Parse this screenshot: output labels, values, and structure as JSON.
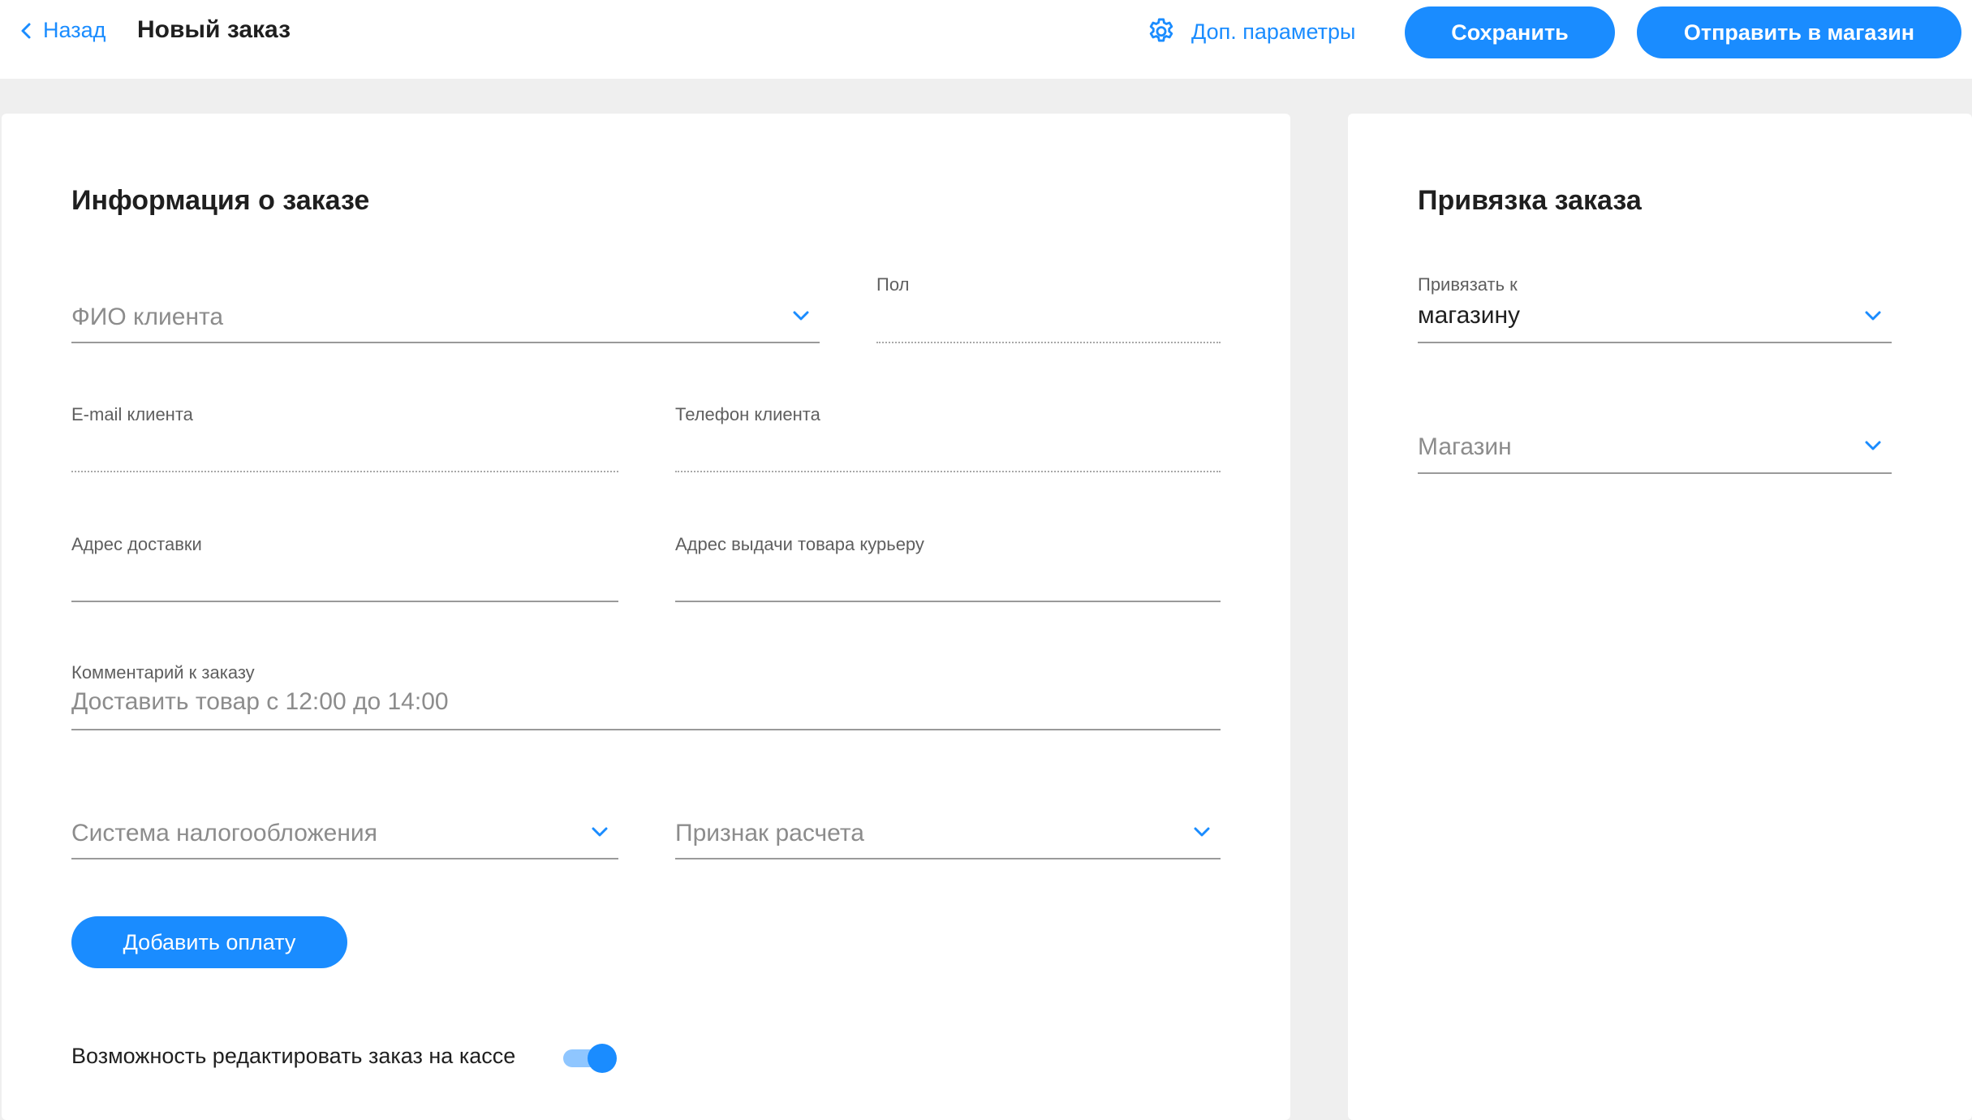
{
  "header": {
    "back_label": "Назад",
    "title": "Новый заказ",
    "extra_params_label": "Доп. параметры",
    "save_label": "Сохранить",
    "send_label": "Отправить в магазин"
  },
  "order_info": {
    "title": "Информация о заказе",
    "client_name": {
      "placeholder": "ФИО клиента"
    },
    "gender": {
      "label": "Пол",
      "value": ""
    },
    "email": {
      "label": "E-mail клиента",
      "value": ""
    },
    "phone": {
      "label": "Телефон клиента",
      "value": ""
    },
    "delivery_address": {
      "label": "Адрес доставки",
      "value": ""
    },
    "courier_address": {
      "label": "Адрес выдачи товара курьеру",
      "value": ""
    },
    "comment": {
      "label": "Комментарий к заказу",
      "placeholder": "Доставить товар с 12:00 до 14:00"
    },
    "tax_system": {
      "placeholder": "Система налогообложения"
    },
    "payment_sign": {
      "placeholder": "Признак расчета"
    },
    "add_payment_label": "Добавить оплату",
    "edit_at_register": {
      "label": "Возможность редактировать заказ на кассе",
      "enabled": true
    }
  },
  "order_binding": {
    "title": "Привязка заказа",
    "bind_to": {
      "label": "Привязать к",
      "value": "магазину"
    },
    "store": {
      "placeholder": "Магазин"
    }
  },
  "colors": {
    "accent": "#1a8cff",
    "background": "#efefef",
    "card": "#ffffff"
  },
  "icons": {
    "back": "chevron-left-icon",
    "settings": "gear-icon",
    "dropdown": "chevron-down-icon"
  }
}
